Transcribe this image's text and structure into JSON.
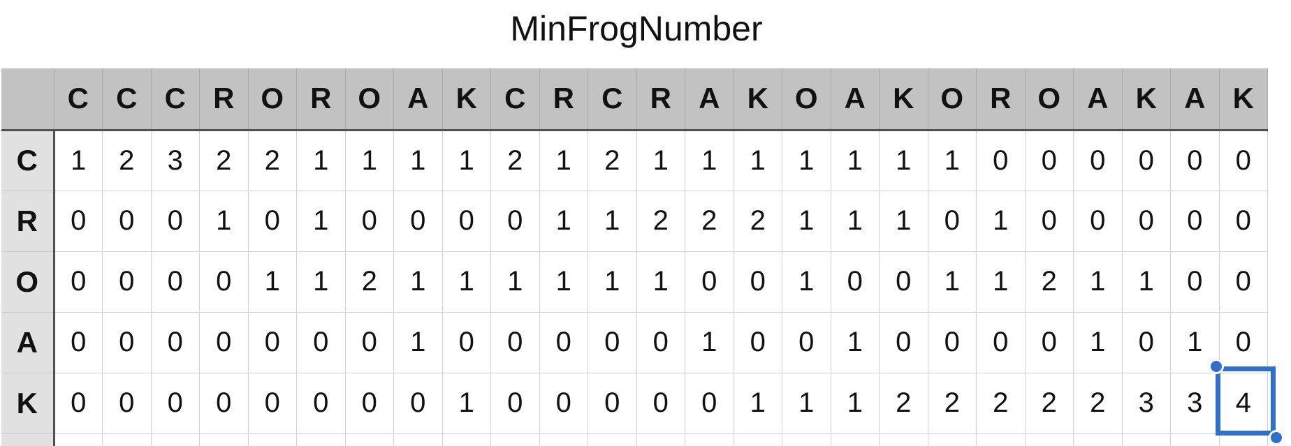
{
  "title": "MinFrogNumber",
  "columns": [
    "C",
    "C",
    "C",
    "R",
    "O",
    "R",
    "O",
    "A",
    "K",
    "C",
    "R",
    "C",
    "R",
    "A",
    "K",
    "O",
    "A",
    "K",
    "O",
    "R",
    "O",
    "A",
    "K",
    "A",
    "K"
  ],
  "rows": [
    {
      "label": "C",
      "values": [
        "1",
        "2",
        "3",
        "2",
        "2",
        "1",
        "1",
        "1",
        "1",
        "2",
        "1",
        "2",
        "1",
        "1",
        "1",
        "1",
        "1",
        "1",
        "1",
        "0",
        "0",
        "0",
        "0",
        "0",
        "0"
      ]
    },
    {
      "label": "R",
      "values": [
        "0",
        "0",
        "0",
        "1",
        "0",
        "1",
        "0",
        "0",
        "0",
        "0",
        "1",
        "1",
        "2",
        "2",
        "2",
        "1",
        "1",
        "1",
        "0",
        "1",
        "0",
        "0",
        "0",
        "0",
        "0"
      ]
    },
    {
      "label": "O",
      "values": [
        "0",
        "0",
        "0",
        "0",
        "1",
        "1",
        "2",
        "1",
        "1",
        "1",
        "1",
        "1",
        "1",
        "0",
        "0",
        "1",
        "0",
        "0",
        "1",
        "1",
        "2",
        "1",
        "1",
        "0",
        "0"
      ]
    },
    {
      "label": "A",
      "values": [
        "0",
        "0",
        "0",
        "0",
        "0",
        "0",
        "0",
        "1",
        "0",
        "0",
        "0",
        "0",
        "0",
        "1",
        "0",
        "0",
        "1",
        "0",
        "0",
        "0",
        "0",
        "1",
        "0",
        "1",
        "0"
      ]
    },
    {
      "label": "K",
      "values": [
        "0",
        "0",
        "0",
        "0",
        "0",
        "0",
        "0",
        "0",
        "1",
        "0",
        "0",
        "0",
        "0",
        "0",
        "1",
        "1",
        "1",
        "2",
        "2",
        "2",
        "2",
        "2",
        "3",
        "3",
        "4"
      ]
    }
  ],
  "selected_cell": {
    "row": "K",
    "value": "4"
  },
  "colors": {
    "header_bg": "#c2c2c2",
    "row_header_bg": "#e1e1e1",
    "selection": "#2f6fce"
  }
}
